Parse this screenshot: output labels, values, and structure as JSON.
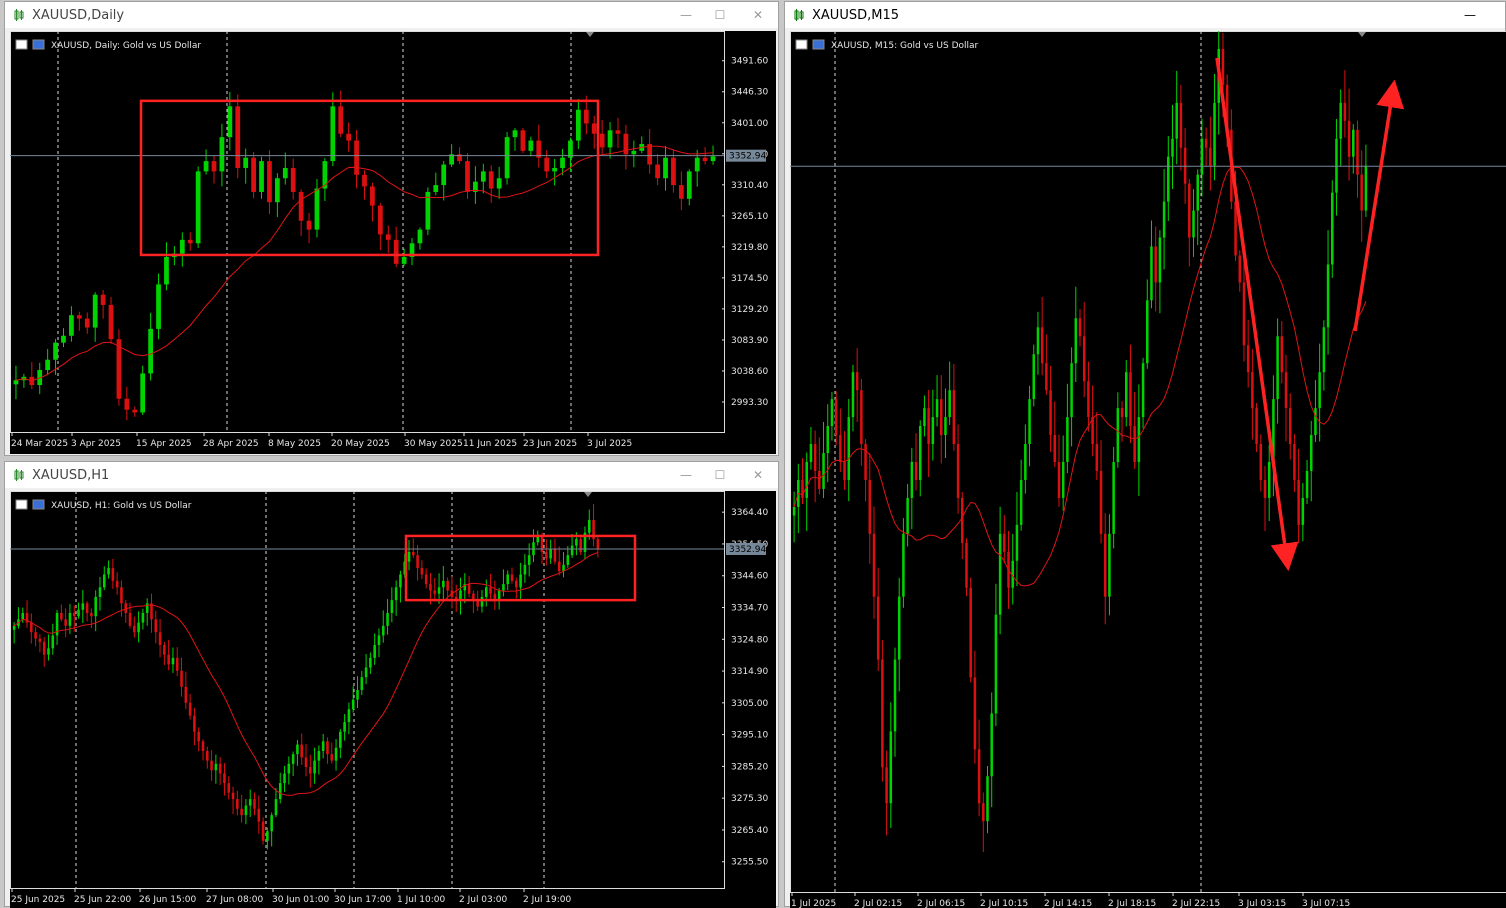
{
  "colors": {
    "bull": "#00d400",
    "bear": "#dc1010",
    "ma": "#e01414",
    "annotation": "#ff2222",
    "grid": "#d8d8d8",
    "bid_line": "#778899"
  },
  "windows": [
    {
      "title": "XAUUSD,Daily",
      "active": false,
      "buttons": [
        "—",
        "☐",
        "✕"
      ]
    },
    {
      "title": "XAUUSD,H1",
      "active": false,
      "buttons": [
        "—",
        "☐",
        "✕"
      ]
    },
    {
      "title": "XAUUSD,M15",
      "active": true,
      "buttons": [
        "—"
      ]
    }
  ],
  "chart_data": [
    {
      "type": "candlestick",
      "title": "XAUUSD, Daily:  Gold vs US Dollar",
      "ylim": [
        2948,
        3535
      ],
      "y_ticks": [
        "3491.60",
        "3446.30",
        "3401.00",
        "3355.70",
        "3310.40",
        "3265.10",
        "3219.80",
        "3174.50",
        "3129.20",
        "3083.90",
        "3038.60",
        "2993.30"
      ],
      "x_ticks": [
        "24 Mar 2025",
        "3 Apr 2025",
        "15 Apr 2025",
        "28 Apr 2025",
        "8 May 2025",
        "20 May 2025",
        "30 May 2025",
        "11 Jun 2025",
        "23 Jun 2025",
        "3 Jul 2025"
      ],
      "current_price": "3352.94",
      "annotation_box": {
        "from": "15 Apr 2025",
        "to": "3 Jul 2025",
        "top": 3433,
        "bottom": 3208
      },
      "closes": [
        3025,
        3030,
        3018,
        3040,
        3055,
        3080,
        3090,
        3120,
        3115,
        3102,
        3150,
        3135,
        3085,
        2998,
        2982,
        2978,
        3035,
        3100,
        3165,
        3205,
        3210,
        3230,
        3225,
        3330,
        3345,
        3330,
        3380,
        3425,
        3335,
        3350,
        3300,
        3345,
        3285,
        3320,
        3335,
        3300,
        3258,
        3245,
        3305,
        3345,
        3425,
        3385,
        3375,
        3325,
        3308,
        3280,
        3238,
        3230,
        3195,
        3205,
        3225,
        3245,
        3300,
        3310,
        3340,
        3355,
        3345,
        3300,
        3315,
        3330,
        3305,
        3320,
        3380,
        3390,
        3360,
        3375,
        3350,
        3330,
        3335,
        3350,
        3375,
        3420,
        3400,
        3385,
        3365,
        3390,
        3385,
        3355,
        3360,
        3370,
        3340,
        3320,
        3350,
        3310,
        3290,
        3330,
        3350,
        3345,
        3352
      ]
    },
    {
      "type": "candlestick",
      "title": "XAUUSD, H1:  Gold vs US Dollar",
      "ylim": [
        3247,
        3371
      ],
      "y_ticks": [
        "3364.40",
        "3354.50",
        "3344.60",
        "3334.70",
        "3324.80",
        "3314.90",
        "3305.00",
        "3295.10",
        "3285.20",
        "3275.30",
        "3265.40",
        "3255.50"
      ],
      "x_ticks": [
        "25 Jun 2025",
        "25 Jun 22:00",
        "26 Jun 15:00",
        "27 Jun 08:00",
        "30 Jun 01:00",
        "30 Jun 17:00",
        "1 Jul 10:00",
        "2 Jul 03:00",
        "2 Jul 19:00"
      ],
      "current_price": "3352.94",
      "annotation_box": {
        "from": "1 Jul 10:00",
        "to": "3 Jul",
        "top": 3357,
        "bottom": 3337
      },
      "closes": [
        3329,
        3331,
        3333,
        3330,
        3327,
        3325,
        3324,
        3320,
        3322,
        3326,
        3333,
        3331,
        3329,
        3333,
        3332,
        3334,
        3336,
        3333,
        3332,
        3338,
        3341,
        3345,
        3347,
        3343,
        3341,
        3336,
        3333,
        3329,
        3327,
        3330,
        3333,
        3336,
        3331,
        3327,
        3323,
        3320,
        3317,
        3319,
        3315,
        3310,
        3305,
        3301,
        3296,
        3293,
        3290,
        3287,
        3284,
        3286,
        3283,
        3280,
        3277,
        3275,
        3272,
        3270,
        3273,
        3275,
        3272,
        3268,
        3262,
        3265,
        3270,
        3275,
        3280,
        3283,
        3286,
        3289,
        3292,
        3288,
        3285,
        3283,
        3287,
        3290,
        3293,
        3289,
        3287,
        3291,
        3296,
        3299,
        3303,
        3306,
        3309,
        3313,
        3316,
        3319,
        3323,
        3326,
        3329,
        3333,
        3337,
        3341,
        3345,
        3349,
        3352,
        3351,
        3347,
        3345,
        3342,
        3340,
        3339,
        3341,
        3343,
        3340,
        3338,
        3337,
        3340,
        3342,
        3339,
        3337,
        3335,
        3338,
        3341,
        3339,
        3337,
        3340,
        3342,
        3345,
        3343,
        3341,
        3345,
        3348,
        3351,
        3355,
        3357,
        3352,
        3350,
        3353,
        3349,
        3346,
        3348,
        3351,
        3354,
        3356,
        3352,
        3358,
        3362,
        3356,
        3353
      ]
    },
    {
      "type": "candlestick",
      "title": "XAUUSD, M15:  Gold vs US Dollar",
      "ylim": [
        3272,
        3368
      ],
      "x_ticks": [
        "1 Jul 2025",
        "2 Jul 02:15",
        "2 Jul 06:15",
        "2 Jul 10:15",
        "2 Jul 14:15",
        "2 Jul 18:15",
        "2 Jul 22:15",
        "3 Jul 03:15",
        "3 Jul 07:15"
      ],
      "current_price": "3352.94",
      "annotation_arrows": [
        {
          "from_price": 3365,
          "to_price": 3309,
          "label": "down"
        },
        {
          "from_price": 3309,
          "to_price": 3361,
          "label": "up"
        }
      ],
      "closes": [
        3315,
        3318,
        3316,
        3320,
        3322,
        3319,
        3317,
        3321,
        3324,
        3327,
        3323,
        3320,
        3318,
        3325,
        3330,
        3328,
        3322,
        3318,
        3312,
        3305,
        3298,
        3286,
        3282,
        3290,
        3298,
        3305,
        3312,
        3316,
        3320,
        3318,
        3324,
        3326,
        3322,
        3325,
        3327,
        3323,
        3325,
        3328,
        3322,
        3316,
        3311,
        3306,
        3296,
        3288,
        3282,
        3280,
        3285,
        3292,
        3303,
        3312,
        3310,
        3306,
        3309,
        3313,
        3318,
        3322,
        3327,
        3332,
        3335,
        3331,
        3328,
        3323,
        3320,
        3316,
        3320,
        3325,
        3331,
        3336,
        3334,
        3329,
        3325,
        3322,
        3319,
        3312,
        3305,
        3312,
        3320,
        3326,
        3325,
        3330,
        3324,
        3320,
        3325,
        3331,
        3338,
        3344,
        3340,
        3345,
        3349,
        3354,
        3356,
        3360,
        3355,
        3351,
        3345,
        3348,
        3352,
        3356,
        3355,
        3353,
        3360,
        3366,
        3362,
        3357,
        3349,
        3343,
        3340,
        3333,
        3330,
        3326,
        3322,
        3318,
        3316,
        3320,
        3327,
        3334,
        3330,
        3326,
        3322,
        3318,
        3313,
        3316,
        3319,
        3323,
        3326,
        3330,
        3335,
        3342,
        3350,
        3356,
        3360,
        3358,
        3354,
        3357,
        3352,
        3348,
        3353
      ]
    }
  ]
}
